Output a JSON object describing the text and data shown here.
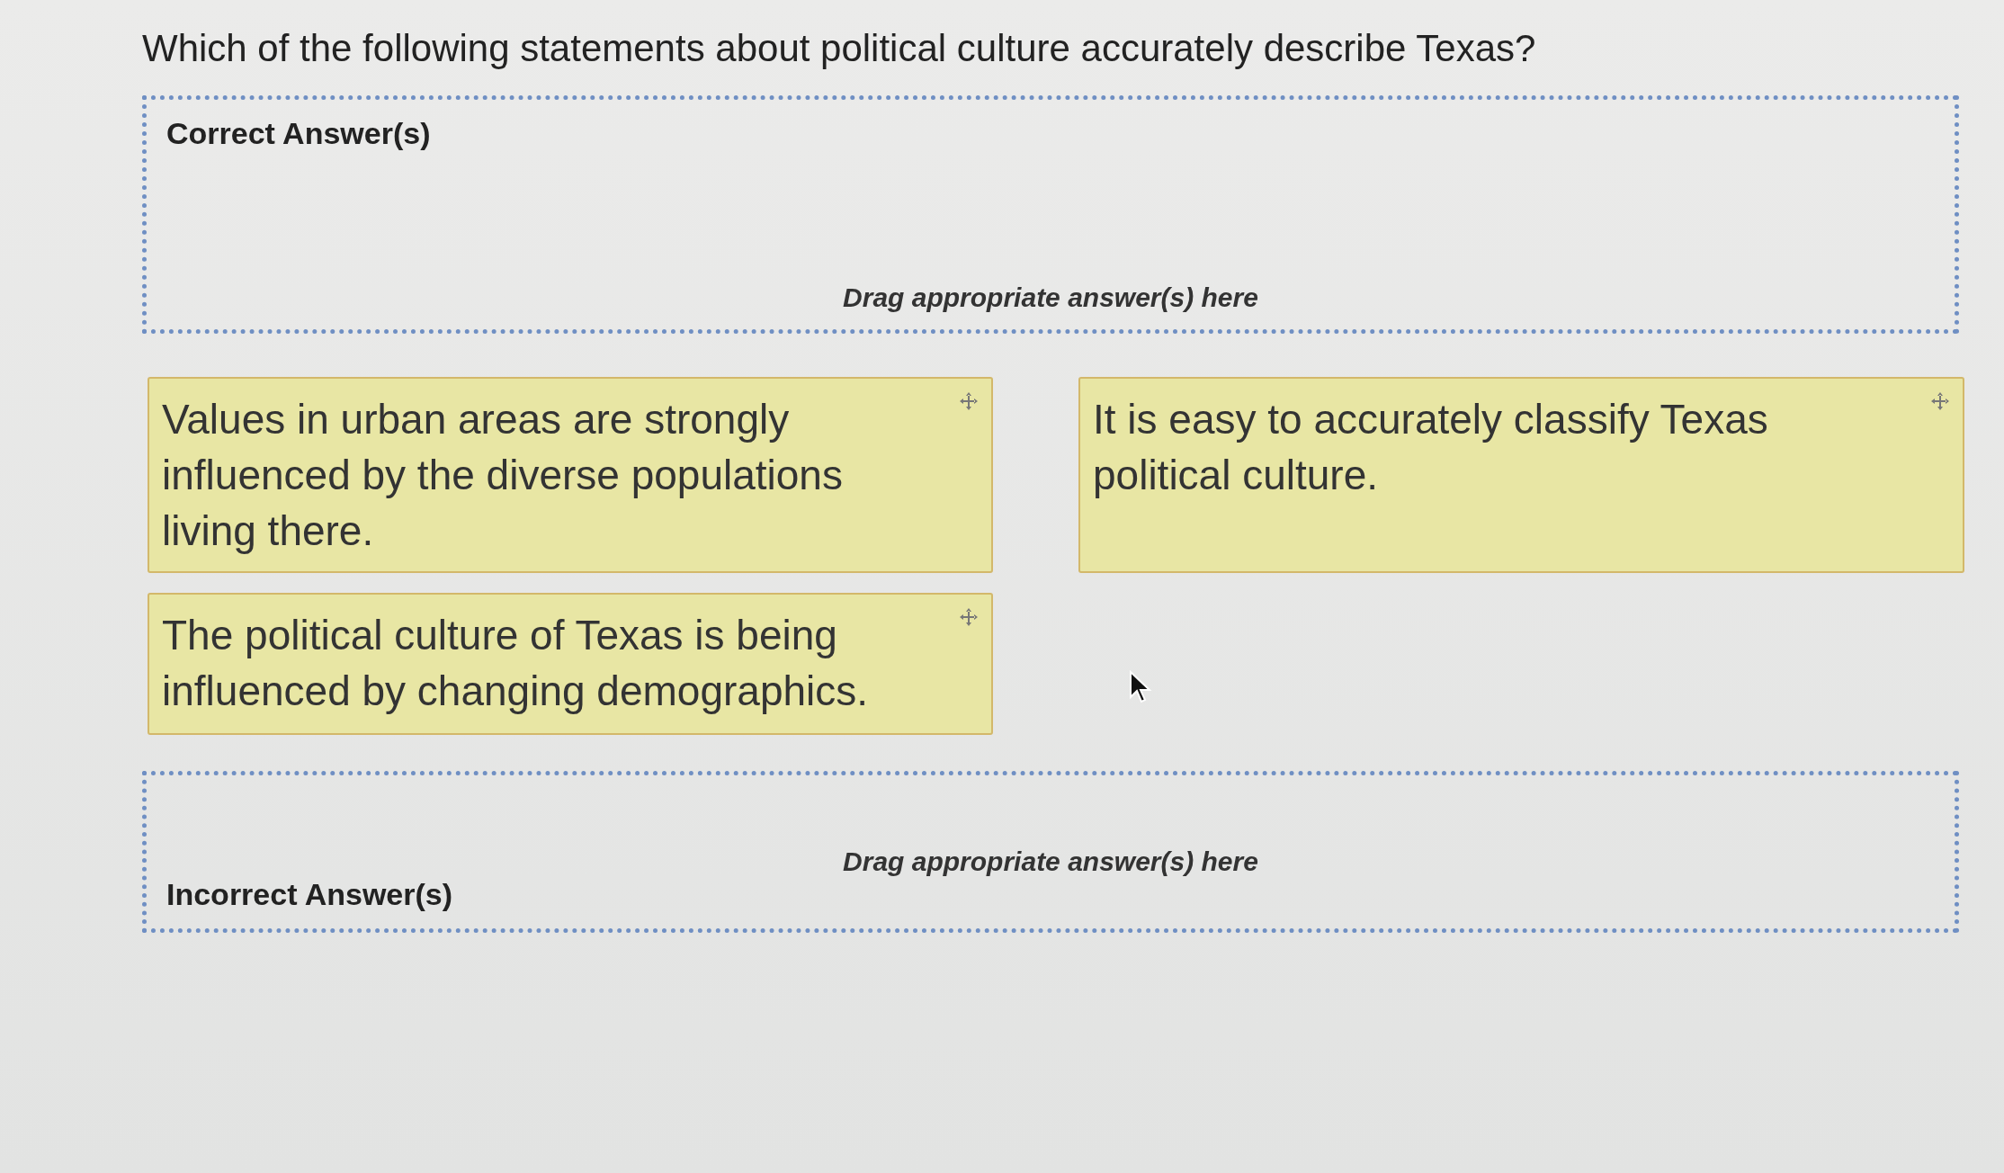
{
  "question": "Which of the following statements about political culture accurately describe Texas?",
  "zones": [
    {
      "kind": "correct",
      "label": "Correct Answer(s)",
      "hint": "Drag appropriate answer(s) here"
    },
    {
      "kind": "incorrect",
      "label": "Incorrect Answer(s)",
      "hint": "Drag appropriate answer(s) here"
    }
  ],
  "options": [
    {
      "text": "Values in urban areas are strongly influenced by the diverse populations living there."
    },
    {
      "text": "It is easy to accurately classify Texas political culture."
    },
    {
      "text": "The political culture of Texas is being influenced by changing demographics."
    }
  ]
}
